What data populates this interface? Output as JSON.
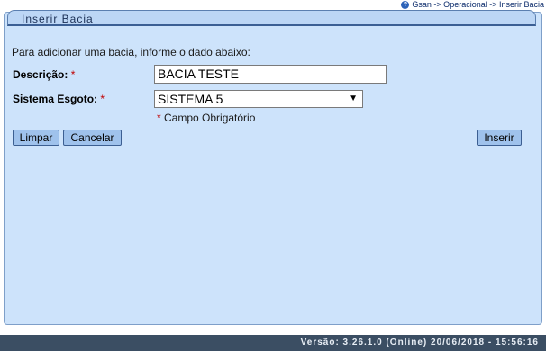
{
  "breadcrumb": {
    "text": "Gsan -> Operacional -> Inserir Bacia",
    "icon": "help-icon"
  },
  "panel": {
    "title": "Inserir Bacia"
  },
  "form": {
    "intro": "Para adicionar uma bacia, informe o dado abaixo:",
    "descricao_label": "Descrição:",
    "descricao_value": "BACIA TESTE",
    "sistema_label": "Sistema Esgoto:",
    "sistema_value": "SISTEMA 5",
    "required_mark": "*",
    "mandatory_text": "Campo Obrigatório"
  },
  "buttons": {
    "limpar": "Limpar",
    "cancelar": "Cancelar",
    "inserir": "Inserir"
  },
  "footer": {
    "version": "Versão: 3.26.1.0 (Online) 20/06/2018 - 15:56:16"
  }
}
